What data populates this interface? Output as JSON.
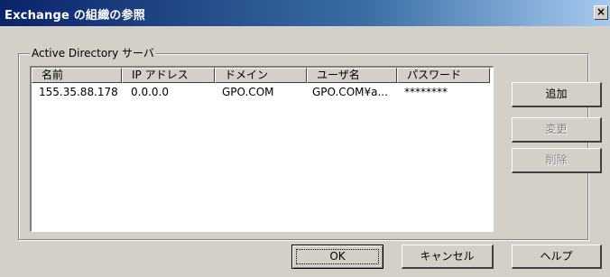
{
  "dialog": {
    "title": "Exchange の組織の参照",
    "close_label": "×"
  },
  "group": {
    "label": "Active Directory サーバ"
  },
  "list": {
    "columns": [
      "名前",
      "IP アドレス",
      "ドメイン",
      "ユーザ名",
      "パスワード"
    ],
    "rows": [
      [
        "155.35.88.178",
        "0.0.0.0",
        "GPO.COM",
        "GPO.COM¥a...",
        "********"
      ]
    ]
  },
  "side_buttons": {
    "add": "追加",
    "change": "変更",
    "delete": "削除"
  },
  "bottom_buttons": {
    "ok": "OK",
    "cancel": "キャンセル",
    "help": "ヘルプ"
  },
  "colors": {
    "titlebar_start": "#0a246a",
    "titlebar_end": "#a6caf0",
    "face": "#d4d0c8",
    "disabled_text": "#808080"
  }
}
